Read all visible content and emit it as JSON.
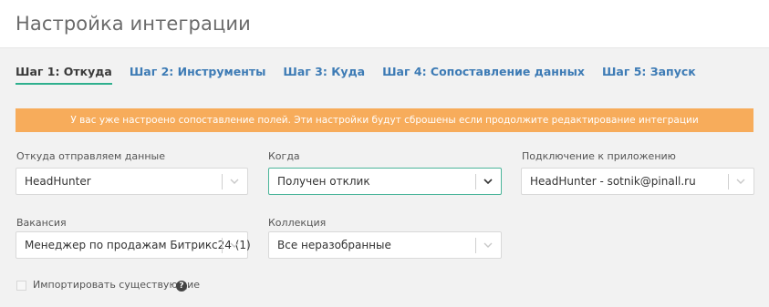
{
  "header": {
    "title": "Настройка интеграции"
  },
  "tabs": [
    {
      "label": "Шаг 1: Откуда",
      "active": true
    },
    {
      "label": "Шаг 2: Инструменты",
      "active": false
    },
    {
      "label": "Шаг 3: Куда",
      "active": false
    },
    {
      "label": "Шаг 4: Сопоставление данных",
      "active": false
    },
    {
      "label": "Шаг 5: Запуск",
      "active": false
    }
  ],
  "alert": {
    "text": "У вас уже настроено сопоставление полей. Эти настройки будут сброшены если продолжите редактирование интеграции",
    "color": "#f7ac5b"
  },
  "form": {
    "source": {
      "label": "Откуда отправляем данные",
      "value": "HeadHunter"
    },
    "when": {
      "label": "Когда",
      "value": "Получен отклик"
    },
    "connection": {
      "label": "Подключение к приложению",
      "value": "HeadHunter - sotnik@pinall.ru"
    },
    "vacancy": {
      "label": "Вакансия",
      "value": "Менеджер по продажам Битрикс24 (1)"
    },
    "collection": {
      "label": "Коллекция",
      "value": "Все неразобранные"
    },
    "import_existing": {
      "label": "Импортировать существующие",
      "checked": false,
      "help_icon": "?"
    }
  },
  "colors": {
    "accent": "#2fb08e",
    "link": "#3d7bb5",
    "focus": "#4bb59a"
  }
}
